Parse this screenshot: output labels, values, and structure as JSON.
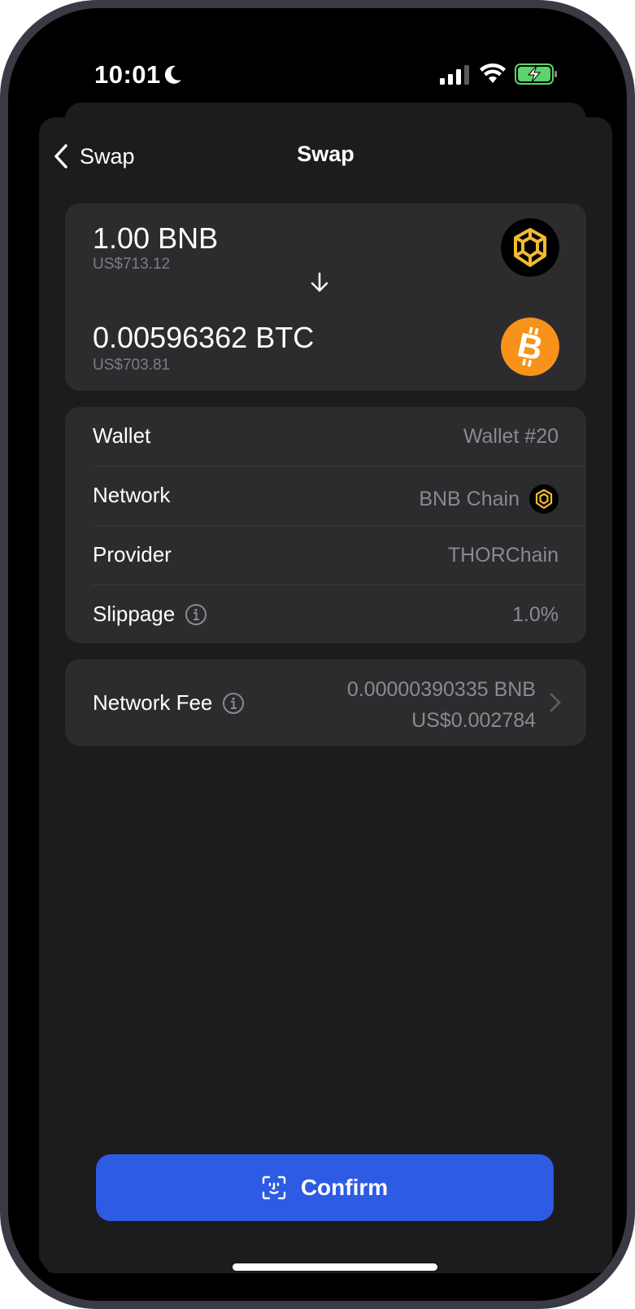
{
  "status_bar": {
    "time": "10:01",
    "icons": [
      "moon-icon",
      "cellular-signal-icon",
      "wifi-icon",
      "battery-charging-icon"
    ]
  },
  "nav": {
    "back_label": "Swap",
    "title": "Swap"
  },
  "swap": {
    "from": {
      "amount": "1.00 BNB",
      "fiat": "US$713.12",
      "icon": "bnb-icon",
      "color": "#f3ba2f"
    },
    "to": {
      "amount": "0.00596362 BTC",
      "fiat": "US$703.81",
      "icon": "bitcoin-icon",
      "color": "#f7931a"
    }
  },
  "details": {
    "wallet": {
      "label": "Wallet",
      "value": "Wallet #20"
    },
    "network": {
      "label": "Network",
      "value": "BNB Chain"
    },
    "provider": {
      "label": "Provider",
      "value": "THORChain"
    },
    "slippage": {
      "label": "Slippage",
      "value": "1.0%"
    }
  },
  "fee": {
    "label": "Network Fee",
    "amount": "0.00000390335 BNB",
    "fiat": "US$0.002784"
  },
  "confirm": {
    "label": "Confirm",
    "color": "#2d5be3"
  }
}
